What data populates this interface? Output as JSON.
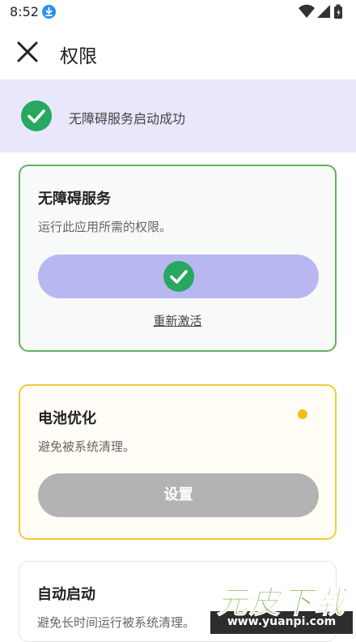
{
  "status_bar": {
    "time": "8:52"
  },
  "app_bar": {
    "title": "权限"
  },
  "banner": {
    "text": "无障碍服务启动成功"
  },
  "accessibility_card": {
    "title": "无障碍服务",
    "description": "运行此应用所需的权限。",
    "relink_label": "重新激活"
  },
  "battery_card": {
    "title": "电池优化",
    "description": "避免被系统清理。",
    "button_label": "设置"
  },
  "autostart_card": {
    "title": "自动启动",
    "description": "避免长时间运行被系统清理。"
  },
  "watermark": {
    "title": "元皮下载",
    "url": "www.yuanpi.com"
  },
  "icons": {
    "download": "download-icon",
    "wifi": "wifi-icon",
    "signal": "signal-icon",
    "battery": "battery-icon",
    "close": "close-icon",
    "check": "check-icon",
    "status_dot": "status-dot"
  },
  "colors": {
    "success": "#27a760",
    "banner_bg": "#e8e7fb",
    "done_pill": "#b8b7f2",
    "card_success_border": "#5fb25f",
    "card_warning_border": "#f2cb38",
    "warning_dot": "#f2bd1c",
    "disabled_button": "#b3b3b3"
  }
}
